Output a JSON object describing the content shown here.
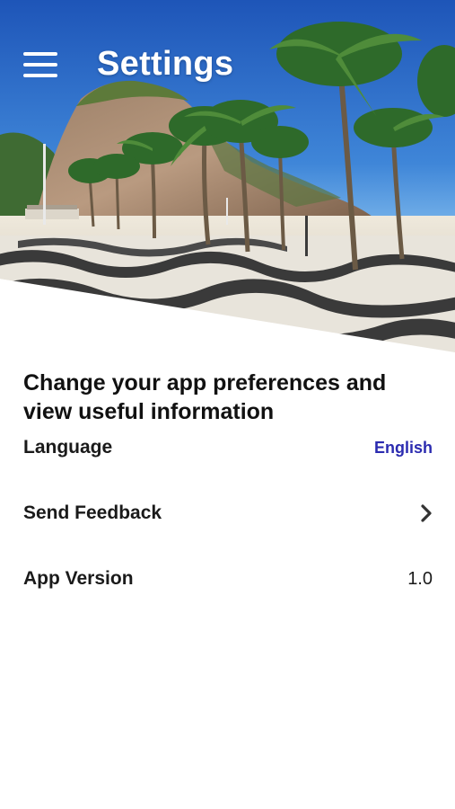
{
  "header": {
    "title": "Settings",
    "menu_icon": "hamburger-menu-icon",
    "hero_image": "beach-promenade-palm-trees"
  },
  "intro": {
    "text": "Change your app preferences and view useful information"
  },
  "settings": {
    "language": {
      "label": "Language",
      "value": "English"
    },
    "feedback": {
      "label": "Send Feedback",
      "icon": "chevron-right-icon"
    },
    "version": {
      "label": "App Version",
      "value": "1.0"
    }
  },
  "colors": {
    "link_accent": "#2b2bb0",
    "text": "#1a1a1a",
    "background": "#ffffff"
  }
}
